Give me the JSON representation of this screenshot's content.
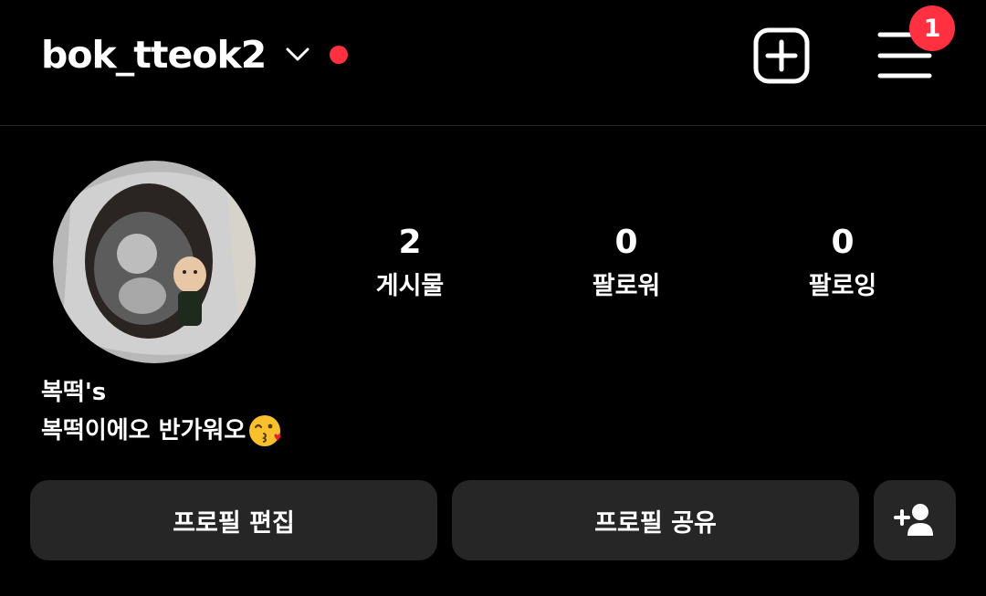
{
  "header": {
    "username": "bok_tteok2",
    "notification_count": "1"
  },
  "stats": [
    {
      "value": "2",
      "label": "게시물"
    },
    {
      "value": "0",
      "label": "팔로워"
    },
    {
      "value": "0",
      "label": "팔로잉"
    }
  ],
  "bio": {
    "name": "복떡's",
    "text": "복떡이에오 반가워오"
  },
  "actions": {
    "edit_label": "프로필 편집",
    "share_label": "프로필 공유"
  },
  "icons": {
    "chevron": "chevron-down-icon",
    "create": "plus-square-icon",
    "menu": "hamburger-menu-icon",
    "add_person": "add-person-icon",
    "emoji": "kissing-face-emoji"
  },
  "colors": {
    "background": "#000000",
    "button": "#262626",
    "badge": "#ff3040",
    "text": "#ffffff"
  }
}
